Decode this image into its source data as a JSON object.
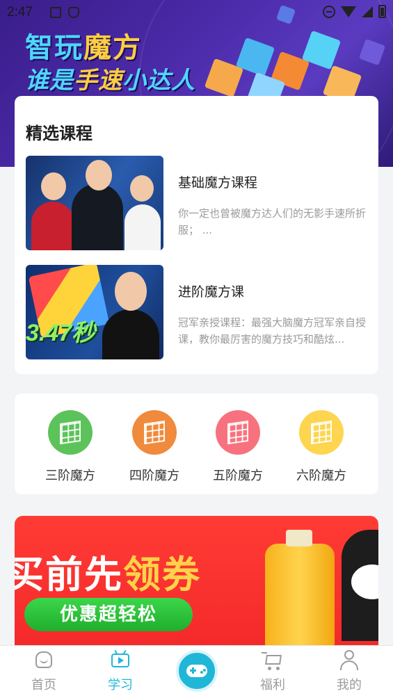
{
  "status_bar": {
    "time": "2:47"
  },
  "hero": {
    "title_part1": "智玩",
    "title_part2": "魔方",
    "subtitle_part1": "谁是",
    "subtitle_part2": "手速",
    "subtitle_part3": "小达人"
  },
  "courses": {
    "heading": "精选课程",
    "items": [
      {
        "title": "基础魔方课程",
        "desc": "你一定也曾被魔方达人们的无影手速所折服； ..."
      },
      {
        "title": "进阶魔方课",
        "desc": "冠军亲授课程：最强大脑魔方冠军亲自授课，教你最厉害的魔方技巧和酷炫..."
      }
    ],
    "thumb2_caption": "3.47秒"
  },
  "levels": [
    {
      "label": "三阶魔方",
      "color": "#5cc25a"
    },
    {
      "label": "四阶魔方",
      "color": "#f08a3c"
    },
    {
      "label": "五阶魔方",
      "color": "#f7727e"
    },
    {
      "label": "六阶魔方",
      "color": "#fdd54f"
    }
  ],
  "promo": {
    "headline_part1": "买前先",
    "headline_part2": "领券",
    "button_label": "优惠超轻松"
  },
  "tabbar": {
    "items": [
      {
        "label": "首页",
        "icon": "home-icon",
        "active": false
      },
      {
        "label": "学习",
        "icon": "tv-play-icon",
        "active": true
      },
      {
        "label": "福利",
        "icon": "cart-icon",
        "active": false
      },
      {
        "label": "我的",
        "icon": "user-icon",
        "active": false
      }
    ],
    "center_icon": "gamepad-icon",
    "accent_color": "#20b6d8"
  }
}
